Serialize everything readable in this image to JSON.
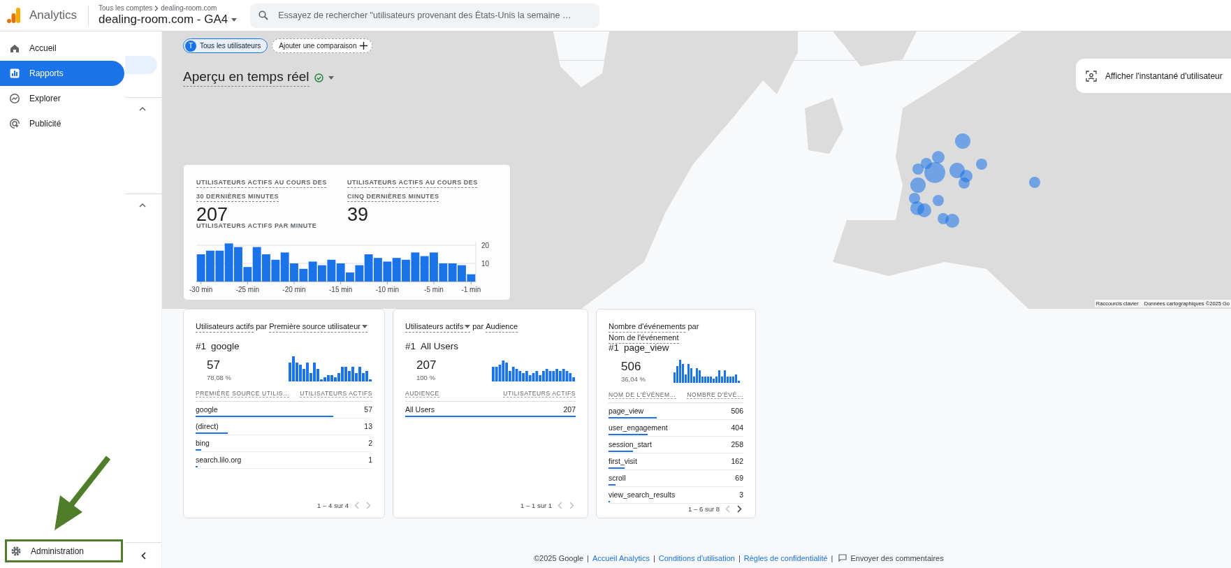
{
  "header": {
    "product": "Analytics",
    "breadcrumb": [
      "Tous les comptes",
      "dealing-room.com"
    ],
    "property": "dealing-room.com - GA4",
    "search": {
      "placeholder": "Essayez de rechercher \"utilisateurs provenant des États-Unis la semaine …"
    }
  },
  "sidebar": {
    "items": [
      {
        "label": "Accueil",
        "selected": false
      },
      {
        "label": "Rapports",
        "selected": true
      },
      {
        "label": "Explorer",
        "selected": false
      },
      {
        "label": "Publicité",
        "selected": false
      }
    ],
    "admin": {
      "label": "Administration",
      "annotated": true
    }
  },
  "filters": [
    {
      "kind": "segment",
      "avatar": "T",
      "label": "Tous les utilisateurs"
    },
    {
      "kind": "add",
      "label": "Ajouter une comparaison"
    }
  ],
  "title": "Aperçu en temps réel",
  "map": {
    "snapshot_button": "Afficher l'instantané d'utilisateur",
    "attribution": [
      "Raccourcis clavier",
      "Données cartographiques ©2025 Go"
    ]
  },
  "realtime": {
    "metrics": [
      {
        "label": "UTILISATEURS ACTIFS AU COURS DES 30 DERNIÈRES MINUTES",
        "value": "207"
      },
      {
        "label": "UTILISATEURS ACTIFS AU COURS DES CINQ DERNIÈRES MINUTES",
        "value": "39"
      }
    ],
    "chart_data": {
      "type": "bar",
      "title": "UTILISATEURS ACTIFS PAR MINUTE",
      "x": [
        -30,
        -29,
        -28,
        -27,
        -26,
        -25,
        -24,
        -23,
        -22,
        -21,
        -20,
        -19,
        -18,
        -17,
        -16,
        -15,
        -14,
        -13,
        -12,
        -11,
        -10,
        -9,
        -8,
        -7,
        -6,
        -5,
        -4,
        -3,
        -2,
        -1
      ],
      "values": [
        15,
        17,
        17,
        21,
        19,
        8,
        19,
        15,
        12,
        16,
        10,
        7,
        11,
        9,
        12,
        10,
        5,
        9,
        15,
        13,
        11,
        13,
        12,
        16,
        14,
        16,
        10,
        10,
        9,
        4
      ],
      "yticks": [
        10,
        20
      ],
      "ylim": [
        0,
        22
      ],
      "xlim": [
        -30.5,
        -0.5
      ],
      "xticks": [
        {
          "value": -30,
          "label": "-30 min"
        },
        {
          "value": -25,
          "label": "-25 min"
        },
        {
          "value": -20,
          "label": "-20 min"
        },
        {
          "value": -15,
          "label": "-15 min"
        },
        {
          "value": -10,
          "label": "-10 min"
        },
        {
          "value": -5,
          "label": "-5 min"
        },
        {
          "value": -1,
          "label": "-1 min"
        }
      ]
    }
  },
  "cards": [
    {
      "metric": "Utilisateurs actifs",
      "metric_dropdown": false,
      "by": "par",
      "dimension": "Première source utilisateur",
      "dimension_dropdown": true,
      "top": {
        "rank": "#1",
        "name": "google",
        "value": "57",
        "percent": "78,08 %"
      },
      "columns": [
        "PREMIÈRE SOURCE UTILIS…",
        "UTILISATEURS ACTIFS"
      ],
      "rows": [
        {
          "name": "google",
          "value": "57",
          "level": 0.78
        },
        {
          "name": "(direct)",
          "value": "13",
          "level": 0.18
        },
        {
          "name": "bing",
          "value": "2",
          "level": 0.03
        },
        {
          "name": "search.lilo.org",
          "value": "1",
          "level": 0.01
        }
      ],
      "pagination": "1 – 4 sur 4",
      "prev_disabled": true,
      "next_disabled": true
    },
    {
      "metric": "Utilisateurs actifs",
      "metric_dropdown": true,
      "by": "par",
      "dimension": "Audience",
      "dimension_dropdown": false,
      "top": {
        "rank": "#1",
        "name": "All Users",
        "value": "207",
        "percent": "100 %"
      },
      "columns": [
        "AUDIENCE",
        "UTILISATEURS ACTIFS"
      ],
      "rows": [
        {
          "name": "All Users",
          "value": "207",
          "level": 1.0
        }
      ],
      "pagination": "1 – 1 sur 1",
      "prev_disabled": true,
      "next_disabled": true
    },
    {
      "metric": "Nombre d'événements",
      "metric_dropdown": false,
      "by": "par",
      "dimension": "Nom de l'événement",
      "dimension_dropdown": false,
      "top": {
        "rank": "#1",
        "name": "page_view",
        "value": "506",
        "percent": "36,04 %"
      },
      "columns": [
        "NOM DE L'ÉVÉNEM…",
        "NOMBRE D'ÉVÉ…"
      ],
      "rows": [
        {
          "name": "page_view",
          "value": "506",
          "level": 0.36
        },
        {
          "name": "user_engagement",
          "value": "404",
          "level": 0.29
        },
        {
          "name": "session_start",
          "value": "258",
          "level": 0.18
        },
        {
          "name": "first_visit",
          "value": "162",
          "level": 0.12
        },
        {
          "name": "scroll",
          "value": "69",
          "level": 0.05
        },
        {
          "name": "view_search_results",
          "value": "3",
          "level": 0.01
        }
      ],
      "pagination": "1 – 6 sur 8",
      "prev_disabled": true,
      "next_disabled": false
    }
  ],
  "footer": {
    "separator": "|",
    "items": [
      {
        "kind": "text",
        "text": "©2025 Google"
      },
      {
        "kind": "link",
        "text": "Accueil Analytics"
      },
      {
        "kind": "link",
        "text": "Conditions d'utilisation"
      },
      {
        "kind": "link",
        "text": "Règles de confidentialité"
      },
      {
        "kind": "feedback",
        "text": "Envoyer des commentaires"
      }
    ]
  }
}
